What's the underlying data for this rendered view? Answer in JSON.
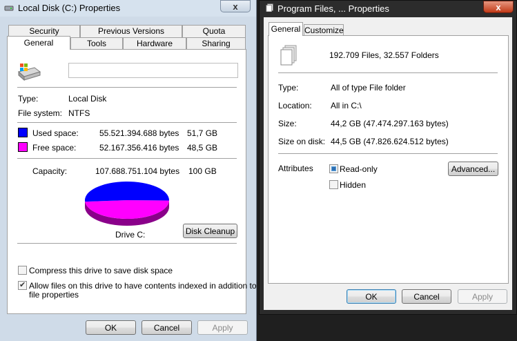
{
  "left": {
    "title": "Local Disk (C:) Properties",
    "close": "x",
    "tabs_back": [
      "Security",
      "Previous Versions",
      "Quota"
    ],
    "tabs_front": [
      "General",
      "Tools",
      "Hardware",
      "Sharing"
    ],
    "name_value": "",
    "type_label": "Type:",
    "type_value": "Local Disk",
    "fs_label": "File system:",
    "fs_value": "NTFS",
    "used_label": "Used space:",
    "used_bytes": "55.521.394.688 bytes",
    "used_gb": "51,7 GB",
    "free_label": "Free space:",
    "free_bytes": "52.167.356.416 bytes",
    "free_gb": "48,5 GB",
    "cap_label": "Capacity:",
    "cap_bytes": "107.688.751.104 bytes",
    "cap_gb": "100 GB",
    "used_fraction": 0.516,
    "drive_label": "Drive C:",
    "disk_cleanup": "Disk Cleanup",
    "compress_label": "Compress this drive to save disk space",
    "index_label_1": "Allow files on this drive to have contents indexed in addition to",
    "index_label_2": "file properties",
    "compress_checked": false,
    "index_checked": true,
    "ok": "OK",
    "cancel": "Cancel",
    "apply": "Apply",
    "colors": {
      "used": "#0000ff",
      "free": "#ff00ff"
    }
  },
  "right": {
    "title": "Program Files, ... Properties",
    "close": "x",
    "tabs": [
      "General",
      "Customize"
    ],
    "files_summary": "192.709 Files, 32.557 Folders",
    "type_label": "Type:",
    "type_value": "All of type File folder",
    "location_label": "Location:",
    "location_value": "All in C:\\",
    "size_label": "Size:",
    "size_value": "44,2 GB (47.474.297.163 bytes)",
    "sizeondisk_label": "Size on disk:",
    "sizeondisk_value": "44,5 GB (47.826.624.512 bytes)",
    "attributes_label": "Attributes",
    "readonly_label": "Read-only",
    "hidden_label": "Hidden",
    "advanced": "Advanced...",
    "ok": "OK",
    "cancel": "Cancel",
    "apply": "Apply"
  }
}
